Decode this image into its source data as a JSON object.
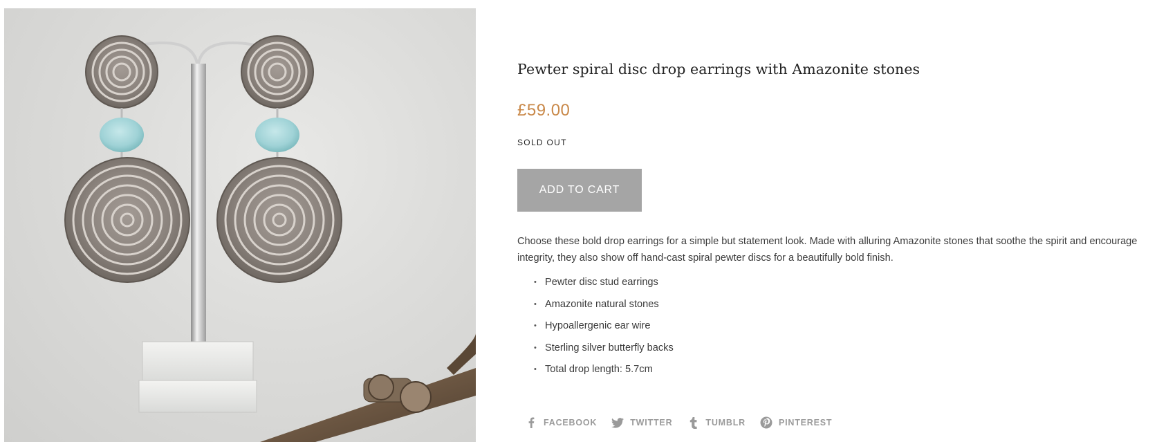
{
  "product": {
    "title": "Pewter spiral disc drop earrings with Amazonite stones",
    "price": "£59.00",
    "stock_status": "SOLD OUT",
    "add_to_cart_label": "ADD TO CART",
    "description": "Choose these bold drop earrings for a simple but statement look. Made with alluring Amazonite stones that soothe the spirit and encourage integrity, they also show off hand-cast spiral pewter discs for a beautifully bold finish.",
    "features": [
      "Pewter disc stud earrings",
      "Amazonite natural stones",
      "Hypoallergenic ear wire",
      "Sterling silver butterfly backs",
      "Total drop length: 5.7cm"
    ]
  },
  "share": {
    "items": [
      {
        "label": "FACEBOOK",
        "icon": "facebook-icon"
      },
      {
        "label": "TWITTER",
        "icon": "twitter-icon"
      },
      {
        "label": "TUMBLR",
        "icon": "tumblr-icon"
      },
      {
        "label": "PINTEREST",
        "icon": "pinterest-icon"
      }
    ]
  },
  "colors": {
    "price": "#c9894a",
    "button_disabled": "#a5a5a5",
    "share_icon": "#9a9a9a",
    "stone": "#9fd2d6"
  }
}
